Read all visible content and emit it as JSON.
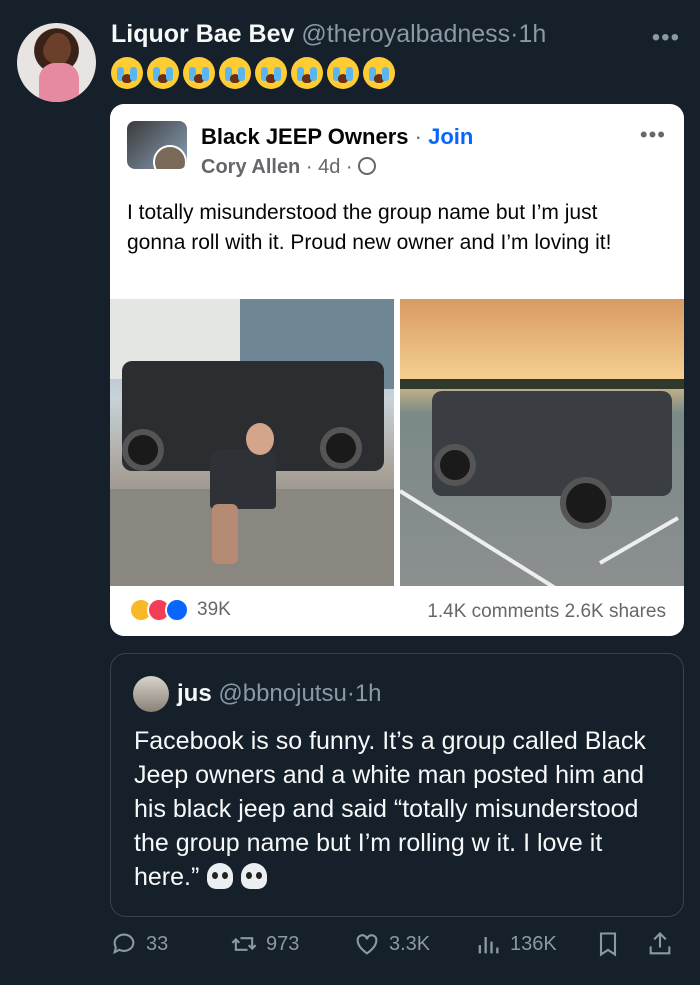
{
  "tweet": {
    "author_name": "Liquor Bae Bev",
    "author_handle": "@theroyalbadness",
    "separator": "·",
    "time": "1h",
    "more_icon": "more-horizontal-icon",
    "emoji_icon": "loudly-crying-face-icon",
    "emoji_count": 8
  },
  "fb_post": {
    "group_name": "Black JEEP Owners",
    "separator": "·",
    "join_label": "Join",
    "author": "Cory Allen",
    "time": "4d",
    "visibility_icon": "globe-icon",
    "text": "I totally misunderstood the group name but I’m just gonna roll with it. Proud new owner and I’m loving it!",
    "reactions_count": "39K",
    "comments": "1.4K comments",
    "shares": "2.6K shares",
    "colors": {
      "join": "#0866ff",
      "like": "#0866ff",
      "love": "#f33e58",
      "haha": "#f7b928"
    }
  },
  "quote": {
    "author_name": "jus",
    "author_handle": "@bbnojutsu",
    "separator": "·",
    "time": "1h",
    "text": "Facebook is so funny. It’s a group called Black Jeep owners and a white man posted him and his black jeep and said “totally misunderstood the group name but I’m rolling w it. I love it here.”",
    "emoji_icon": "skull-icon",
    "emoji_count": 2
  },
  "actions": {
    "replies": "33",
    "retweets": "973",
    "likes": "3.3K",
    "views": "136K"
  },
  "theme": {
    "background": "#15202b",
    "muted": "#8b98a5",
    "border": "#38444d"
  }
}
